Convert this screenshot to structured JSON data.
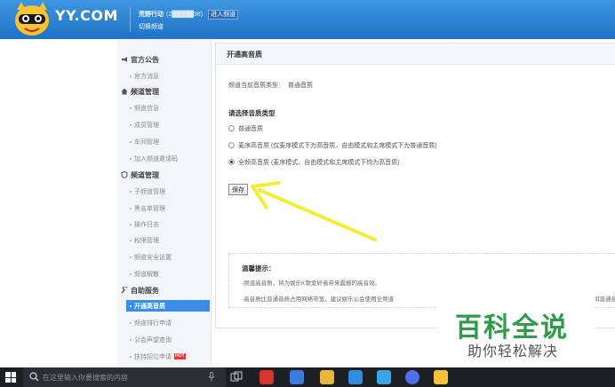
{
  "header": {
    "logo_text": "YY.COM",
    "channel_name": "荒野行动",
    "channel_id": "(2█████98)",
    "enter_button": "进入频道",
    "switch_link": "切换频道"
  },
  "sidebar": {
    "groups": [
      {
        "label": "官方公告",
        "icon": "megaphone-icon",
        "items": [
          "官方消息"
        ]
      },
      {
        "label": "频道管理",
        "icon": "house-icon",
        "items": [
          "频道信息",
          "成员管理",
          "车间管理",
          "加入频道邀请码"
        ]
      },
      {
        "label": "频道管理",
        "icon": "shield-icon",
        "items": [
          "子频道管理",
          "黑名单管理",
          "操作日志",
          "权限管理",
          "频道安全设置",
          "频道解散"
        ]
      },
      {
        "label": "自助服务",
        "icon": "wrench-icon",
        "items": [
          "开通高音质",
          "频道排行申请",
          "公会声望查询",
          "扶持招位申请"
        ]
      }
    ],
    "active_item": "开通高音质",
    "hot_badge": "HOT"
  },
  "main": {
    "title": "开通高音质",
    "current_label": "频道当前音质类型：",
    "current_value": "普通音质",
    "select_label": "请选择音质类型",
    "options": [
      {
        "label": "普通音质",
        "checked": false
      },
      {
        "label": "麦序高音质 (仅麦序模式下为高音质，自由模式和主席模式下为普通音质)",
        "checked": false
      },
      {
        "label": "全频高音质 (麦序模式、自由模式和主席模式下均为高音质)",
        "checked": true
      }
    ],
    "save_button": "保存",
    "tips": {
      "title": "温馨提示：",
      "lines": [
        "-频道高音质，将为娱乐K歌爱好者带来震撼的高音效。",
        "-高音质比普通音质占用网络带宽，建议娱乐公会使用全频道"
      ],
      "tail": "和普通音"
    }
  },
  "watermark": {
    "title": "百科全说",
    "subtitle": "助你轻松解决"
  },
  "taskbar": {
    "search_placeholder": "在这里输入你要搜索的内容"
  },
  "colors": {
    "header_blue": "#2a7fd4",
    "active_blue": "#3a8ee6",
    "arrow_yellow": "#f2ec3a",
    "watermark_green": "#2e9c4a"
  }
}
